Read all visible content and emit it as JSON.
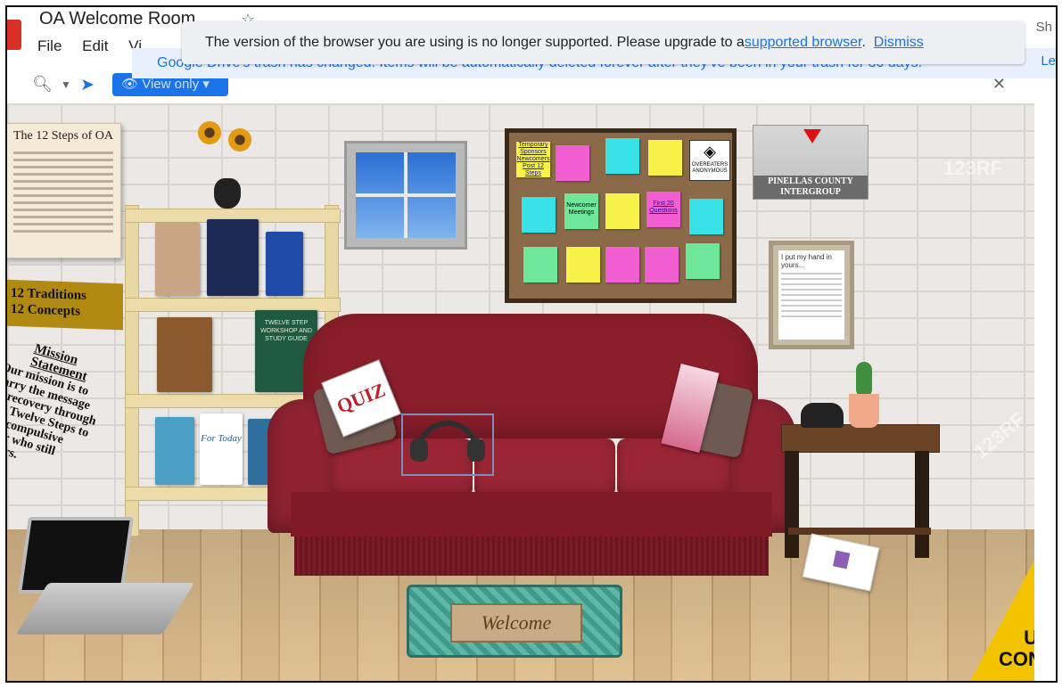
{
  "app": {
    "title": "OA Welcome Room",
    "menu": [
      "File",
      "Edit",
      "Vi"
    ],
    "share_hint": "Sh",
    "learn_hint": "Le"
  },
  "toolbar": {
    "view_only_label": "View only"
  },
  "banners": {
    "trash": "Google Drive's trash has changed. Items will be automatically deleted forever after they've been in your trash for 30 days.",
    "browser_prefix": "The version of the browser you are using is no longer supported. Please upgrade to a",
    "browser_link": "supported browser",
    "browser_sep": ".",
    "browser_dismiss": "Dismiss"
  },
  "room": {
    "steps_title": "The 12 Steps of OA",
    "traditions": "12 Traditions",
    "concepts": "12 Concepts",
    "mission_title": "Mission Statement",
    "mission_text": "Our mission is to carry the message of recovery through the Twelve Steps to the compulsive eater who still suffers.",
    "notes": [
      {
        "text": "Temporary Sponsors Newcomers Post 12 Steps",
        "color": "#f7f34a",
        "link": true
      },
      {
        "text": "",
        "color": "#f25fd3",
        "link": false
      },
      {
        "text": "",
        "color": "#38e2e6",
        "link": false
      },
      {
        "text": "",
        "color": "#f7f34a",
        "link": false
      },
      {
        "text": "",
        "color": "#38e2e6",
        "link": false
      },
      {
        "text": "Newcomer Meetings",
        "color": "#6ee79a",
        "link": false
      },
      {
        "text": "",
        "color": "#f7f34a",
        "link": false
      },
      {
        "text": "First 20 Questions",
        "color": "#f25fd3",
        "link": true
      },
      {
        "text": "",
        "color": "#38e2e6",
        "link": false
      },
      {
        "text": "",
        "color": "#6ee79a",
        "link": false
      },
      {
        "text": "",
        "color": "#f7f34a",
        "link": false
      },
      {
        "text": "",
        "color": "#f25fd3",
        "link": false
      },
      {
        "text": "",
        "color": "#f25fd3",
        "link": false
      },
      {
        "text": "",
        "color": "#6ee79a",
        "link": false
      }
    ],
    "oa_logo": "OVEREATERS ANONYMOUS",
    "pinellas_line1": "PINELLAS COUNTY",
    "pinellas_line2": "INTERGROUP",
    "poem_title": "I put my hand in yours...",
    "quiz": "QUIZ",
    "book_twelve_step": "TWELVE STEP WORKSHOP AND STUDY GUIDE",
    "book_for_today": "For Today",
    "rug": "Welcome",
    "caution_line1": "U",
    "caution_line2": "CON",
    "watermark": "123RF"
  },
  "colors": {
    "accent": "#1a73e8",
    "sofa": "#8b1e2b"
  }
}
